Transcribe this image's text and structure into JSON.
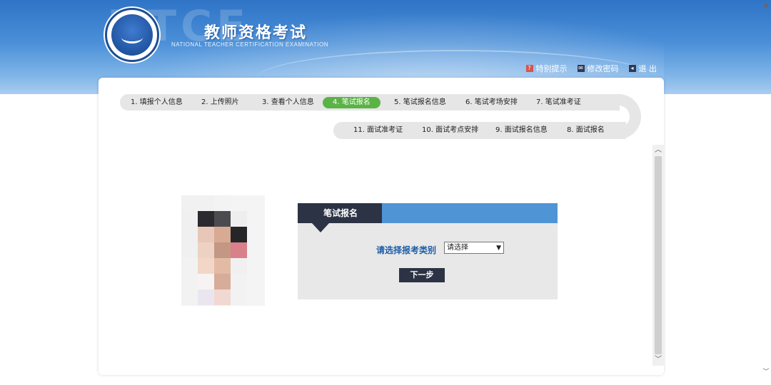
{
  "header": {
    "watermark": "NTCE",
    "title": "教师资格考试",
    "subtitle": "NATIONAL TEACHER CERTIFICATION EXAMINATION",
    "links": [
      {
        "label": "特别提示",
        "icon": "alert-icon"
      },
      {
        "label": "修改密码",
        "icon": "key-icon"
      },
      {
        "label": "退 出",
        "icon": "exit-icon"
      }
    ]
  },
  "steps": {
    "top": [
      "1. 填报个人信息",
      "2. 上传照片",
      "3. 查看个人信息",
      "4. 笔试报名",
      "5. 笔试报名信息",
      "6. 笔试考场安排",
      "7. 笔试准考证"
    ],
    "bottom": [
      "11. 面试准考证",
      "10. 面试考点安排",
      "9. 面试报名信息",
      "8. 面试报名"
    ],
    "active": "4. 笔试报名"
  },
  "form": {
    "tab_label": "笔试报名",
    "field_label": "请选择报考类别",
    "select_value": "请选择",
    "next_label": "下一步"
  },
  "colors": {
    "header_blue": "#2f74c6",
    "active_step": "#5bb346",
    "dark_tab": "#2c3344",
    "form_head": "#4f95d6",
    "label_blue": "#1e5fa8"
  }
}
